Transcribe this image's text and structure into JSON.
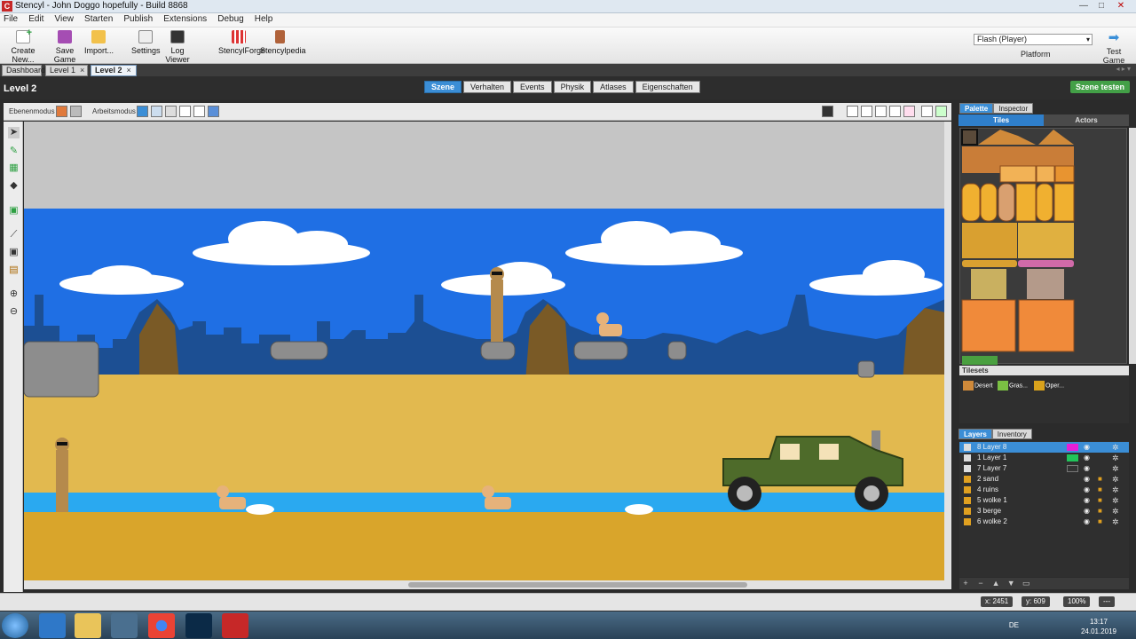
{
  "window": {
    "title": "Stencyl - John Doggo hopefully - Build 8868",
    "minimize": "—",
    "maximize": "□",
    "close": "✕"
  },
  "menu": [
    "File",
    "Edit",
    "View",
    "Starten",
    "Publish",
    "Extensions",
    "Debug",
    "Help"
  ],
  "toolbar": {
    "create_new": "Create New...",
    "save_game": "Save Game",
    "import": "Import...",
    "settings": "Settings",
    "log_viewer": "Log Viewer",
    "stencylforge": "StencylForge",
    "stencylpedia": "Stencylpedia",
    "platform_select": "Flash (Player)",
    "platform_label": "Platform",
    "test_game": "Test Game"
  },
  "doc_tabs": [
    {
      "label": "Dashboard"
    },
    {
      "label": "Level 1",
      "close": "×"
    },
    {
      "label": "Level 2",
      "close": "×"
    }
  ],
  "scene": {
    "title": "Level 2",
    "tabs": [
      "Szene",
      "Verhalten",
      "Events",
      "Physik",
      "Atlases",
      "Eigenschaften"
    ],
    "test_button": "Szene testen",
    "ebenenmodus": "Ebenenmodus",
    "arbeitsmodus": "Arbeitsmodus"
  },
  "right_panel": {
    "tabs": [
      "Palette",
      "Inspector"
    ],
    "subtabs": [
      "Tiles",
      "Actors"
    ],
    "tilesets_header": "Tilesets",
    "tilesets": [
      {
        "name": "Desert",
        "color": "#d08a3a"
      },
      {
        "name": "Gras...",
        "color": "#7ac043"
      },
      {
        "name": "Oper...",
        "color": "#d9a21c"
      }
    ],
    "layers_tabs": [
      "Layers",
      "Inventory"
    ],
    "layers": [
      {
        "name": "8  Layer 8",
        "color": "#e61ed6",
        "selected": true,
        "locked": false
      },
      {
        "name": "1  Layer 1",
        "color": "#21c45a",
        "selected": false,
        "locked": false
      },
      {
        "name": "7  Layer 7",
        "color": "#333333",
        "selected": false,
        "locked": false
      },
      {
        "name": "2  sand",
        "color": "",
        "selected": false,
        "locked": true
      },
      {
        "name": "4  ruins",
        "color": "",
        "selected": false,
        "locked": true
      },
      {
        "name": "5  wolke 1",
        "color": "",
        "selected": false,
        "locked": true
      },
      {
        "name": "3  berge",
        "color": "",
        "selected": false,
        "locked": true
      },
      {
        "name": "6  wolke 2",
        "color": "",
        "selected": false,
        "locked": true
      }
    ],
    "layer_footer": [
      "+",
      "−",
      "▲",
      "▼",
      "▭"
    ]
  },
  "status": {
    "x": "x:  2451",
    "y": "y:  609",
    "zoom": "100%",
    "misc": "---"
  },
  "taskbar": {
    "lang": "DE",
    "time": "13:17",
    "date": "24.01.2019"
  },
  "colors": {
    "accent": "#3b8ed6",
    "green": "#43a047",
    "sky": "#1f6fe4",
    "sand": "#e2b94f"
  }
}
